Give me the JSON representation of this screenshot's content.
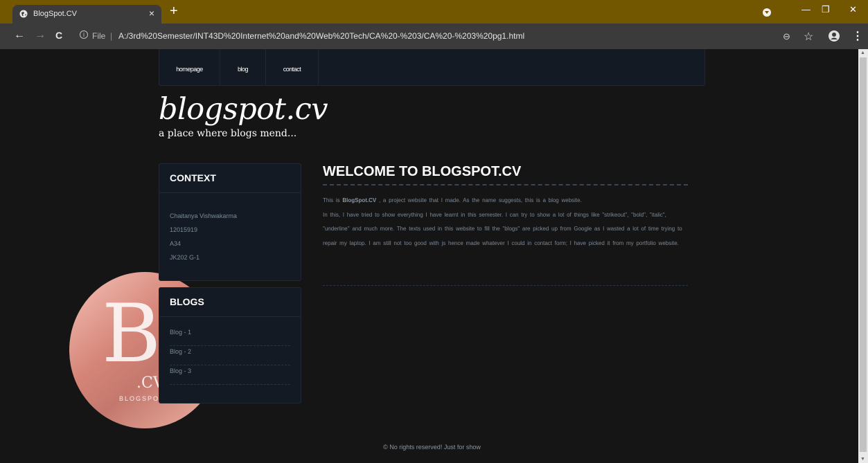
{
  "browser": {
    "tab_title": "BlogSpot.CV",
    "tab_close": "×",
    "new_tab": "+",
    "file_label": "File",
    "separator": "|",
    "url": "A:/3rd%20Semester/INT43D%20Internet%20and%20Web%20Tech/CA%20-%203/CA%20-%203%20pg1.html",
    "back": "←",
    "forward": "→",
    "reload": "C",
    "minimize": "—",
    "restore": "❐",
    "close": "✕",
    "zoom": "⊖",
    "star": "☆",
    "menu": "⋮"
  },
  "nav": {
    "items": [
      {
        "label": "homepage"
      },
      {
        "label": "blog"
      },
      {
        "label": "contact"
      }
    ]
  },
  "site": {
    "title": "blogspot.cv",
    "tagline": "a place where blogs mend..."
  },
  "logo": {
    "big": "BS",
    "small": ".CV",
    "word": "BLOGSPOT"
  },
  "context": {
    "heading": "CONTEXT",
    "lines": [
      "Chaitanya Vishwakarma",
      "12015919",
      "A34",
      "JK202 G-1"
    ]
  },
  "blogs": {
    "heading": "BLOGS",
    "items": [
      "Blog - 1",
      "Blog - 2",
      "Blog - 3"
    ]
  },
  "main": {
    "heading": "WELCOME TO BLOGSPOT.CV",
    "p1_before": "This is ",
    "p1_bold": "BlogSpot.CV",
    "p1_after": " , a project website that I made. As the name suggests, this is a blog website.",
    "p2": "In this, I have tried to show everything I have learnt in this semester. I can try to show a lot of things like \"strikeout\", \"bold\", \"italic\", \"underline\" and much more. The texts used in this website to fill the \"blogs\" are picked up from Google as I wasted a lot of time trying to repair my laptop. I am still not too good with js hence made whatever I could in contact form; I have picked it from my portfolio website."
  },
  "footer": {
    "text": "© No rights reserved! Just for show"
  }
}
